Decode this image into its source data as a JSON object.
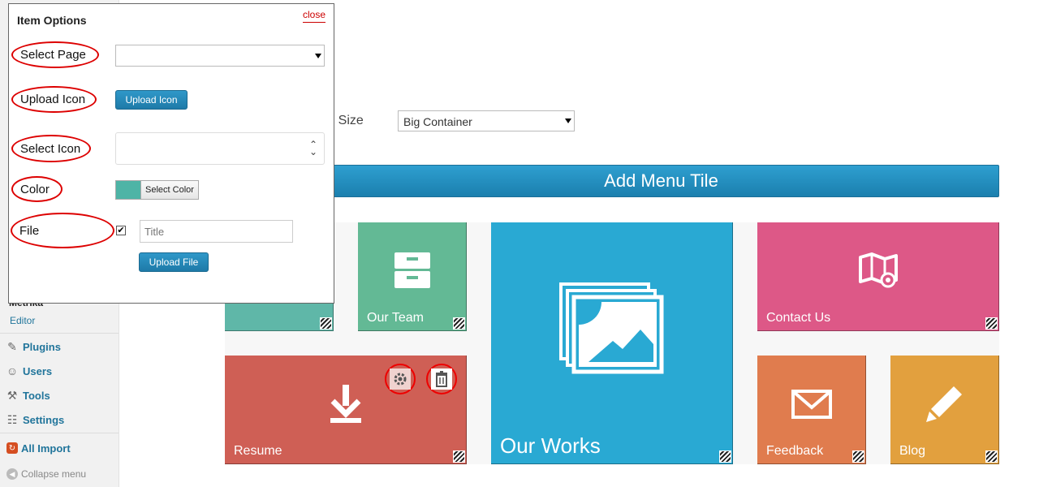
{
  "modal": {
    "title": "Item Options",
    "close_label": "close",
    "labels": {
      "select_page": "Select Page",
      "upload_icon": "Upload Icon",
      "select_icon": "Select Icon",
      "color": "Color",
      "file": "File"
    },
    "select_page_value": "",
    "upload_icon_button": "Upload Icon",
    "select_icon_value": "",
    "color_swatch": "#4eb4a6",
    "select_color_button": "Select Color",
    "file_checked": true,
    "title_placeholder": "Title",
    "upload_file_button": "Upload File"
  },
  "sidebar": {
    "metrika_label": "Metrika",
    "editor_link": "Editor",
    "items": [
      {
        "label": "Plugins",
        "icon": "plug-icon"
      },
      {
        "label": "Users",
        "icon": "users-icon"
      },
      {
        "label": "Tools",
        "icon": "wrench-icon"
      },
      {
        "label": "Settings",
        "icon": "settings-icon"
      },
      {
        "label": "All Import",
        "icon": "import-icon"
      },
      {
        "label": "Collapse menu",
        "icon": "collapse-icon"
      }
    ]
  },
  "main": {
    "container_size_label": "er Size",
    "container_size_value": "Big Container",
    "add_tile_label": "Add Menu Tile",
    "tiles": [
      {
        "label": "",
        "color": "#5fb7a8"
      },
      {
        "label": "Our Team",
        "color": "#63b995",
        "icon": "drawer-icon"
      },
      {
        "label": "Our Works",
        "color": "#29a9d3",
        "icon": "gallery-icon"
      },
      {
        "label": "Contact Us",
        "color": "#dd5887",
        "icon": "map-icon"
      },
      {
        "label": "Resume",
        "color": "#cf5f55",
        "icon": "download-icon"
      },
      {
        "label": "Feedback",
        "color": "#e07c4e",
        "icon": "mail-icon"
      },
      {
        "label": "Blog",
        "color": "#e2a03e",
        "icon": "pencil-icon"
      }
    ]
  }
}
